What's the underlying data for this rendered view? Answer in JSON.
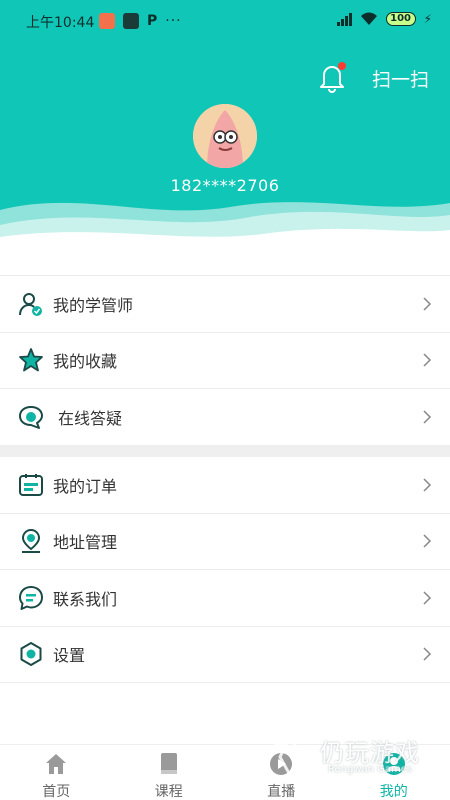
{
  "status_bar": {
    "time": "上午10:44",
    "app_badge": "P",
    "more": "···",
    "battery": "100"
  },
  "header": {
    "scan_label": "扫一扫",
    "phone": "182****2706",
    "colors": {
      "primary": "#10c6b6",
      "notification_dot": "#ff3b30"
    }
  },
  "menu": {
    "group1": [
      {
        "label": "我的学管师",
        "icon": "person-check-icon"
      },
      {
        "label": "我的收藏",
        "icon": "star-icon"
      },
      {
        "label": "在线答疑",
        "icon": "chat-bubble-icon"
      }
    ],
    "group2": [
      {
        "label": "我的订单",
        "icon": "calendar-list-icon"
      },
      {
        "label": "地址管理",
        "icon": "location-pin-icon"
      },
      {
        "label": "联系我们",
        "icon": "message-icon"
      },
      {
        "label": "设置",
        "icon": "gear-icon"
      }
    ]
  },
  "tabbar": {
    "tabs": [
      {
        "label": "首页",
        "icon": "home-icon",
        "active": false
      },
      {
        "label": "课程",
        "icon": "book-icon",
        "active": false
      },
      {
        "label": "直播",
        "icon": "play-icon",
        "active": false
      },
      {
        "label": "我的",
        "icon": "profile-icon",
        "active": true
      }
    ]
  },
  "watermark": {
    "title": "仍玩游戏",
    "subtitle": "Rengwan Games"
  }
}
